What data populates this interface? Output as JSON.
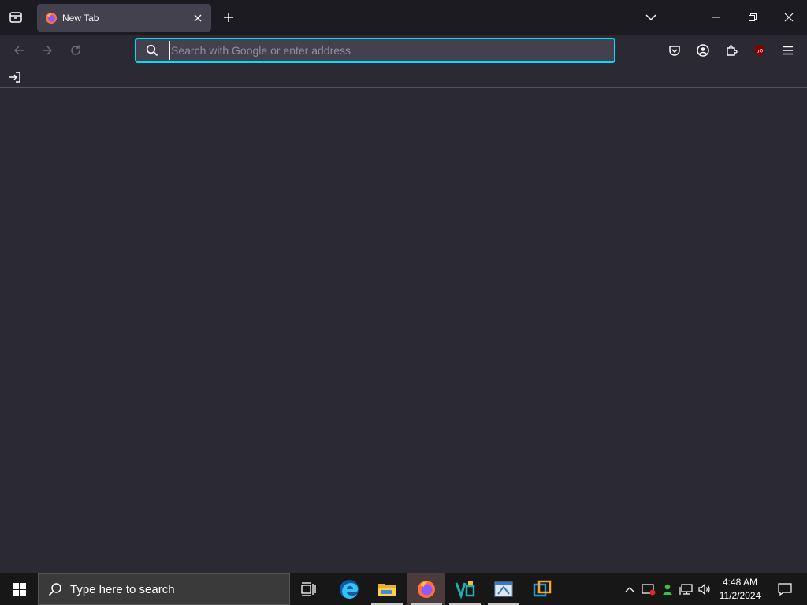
{
  "browser": {
    "tabs": [
      {
        "title": "New Tab",
        "active": true
      }
    ],
    "urlbar": {
      "placeholder": "Search with Google or enter address",
      "value": ""
    },
    "icons": {
      "tab_list": "firefox-view-icon",
      "tab_favicon": "firefox-logo-icon",
      "tab_close": "close-icon",
      "new_tab": "plus-icon",
      "list_all_tabs": "chevron-down-icon",
      "back": "arrow-left-icon",
      "forward": "arrow-right-icon",
      "reload": "reload-icon",
      "search": "search-icon",
      "pocket": "pocket-icon",
      "account": "account-icon",
      "extensions": "puzzle-icon",
      "ublock": "ublock-icon",
      "menu": "hamburger-icon",
      "import_bookmarks": "import-icon"
    },
    "colors": {
      "chrome_bg": "#1c1b22",
      "toolbar_bg": "#2b2a33",
      "tab_active_bg": "#42414d",
      "focus_ring": "#00ddff",
      "ublock_red": "#800000"
    }
  },
  "taskbar": {
    "search_placeholder": "Type here to search",
    "pinned_apps": [
      {
        "name": "Task View",
        "icon": "task-view-icon"
      },
      {
        "name": "Microsoft Edge",
        "icon": "edge-icon"
      },
      {
        "name": "File Explorer",
        "icon": "folder-icon"
      },
      {
        "name": "Firefox",
        "icon": "firefox-icon",
        "active": true
      },
      {
        "name": "App",
        "icon": "app-icon"
      },
      {
        "name": "App",
        "icon": "app-icon"
      },
      {
        "name": "VirtualBox",
        "icon": "virtualbox-icon"
      }
    ],
    "clock": {
      "time": "4:48 AM",
      "date": "11/2/2024"
    }
  }
}
